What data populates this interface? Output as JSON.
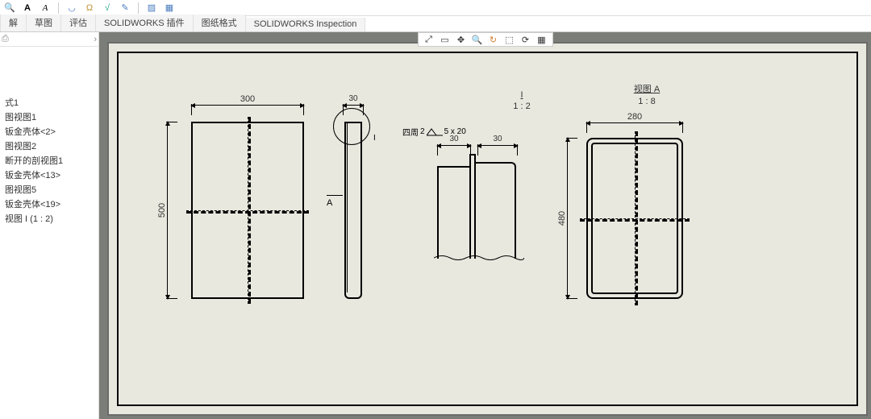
{
  "toolbar_icons": [
    {
      "name": "find-icon",
      "glyph": "🔍"
    },
    {
      "name": "text-icon",
      "glyph": "A"
    },
    {
      "name": "text-style-icon",
      "glyph": "A"
    },
    {
      "name": "arc-icon",
      "glyph": "◡"
    },
    {
      "name": "balloon-icon",
      "glyph": "Ω"
    },
    {
      "name": "check-icon",
      "glyph": "√"
    },
    {
      "name": "centerline-icon",
      "glyph": "✎"
    },
    {
      "name": "hatch-icon",
      "glyph": "▨"
    },
    {
      "name": "block-icon",
      "glyph": "▦"
    }
  ],
  "tabs": [
    {
      "label": "解"
    },
    {
      "label": "草图"
    },
    {
      "label": "评估"
    },
    {
      "label": "SOLIDWORKS 插件"
    },
    {
      "label": "图纸格式"
    },
    {
      "label": "SOLIDWORKS Inspection"
    }
  ],
  "float_icons": [
    {
      "name": "zoom-fit-icon",
      "glyph": "⤢"
    },
    {
      "name": "zoom-window-icon",
      "glyph": "▭"
    },
    {
      "name": "pan-icon",
      "glyph": "✥"
    },
    {
      "name": "zoom-icon",
      "glyph": "🔍"
    },
    {
      "name": "rotate-icon",
      "glyph": "↻"
    },
    {
      "name": "view-icon",
      "glyph": "⬚"
    },
    {
      "name": "refresh-icon",
      "glyph": "⟳"
    },
    {
      "name": "display-icon",
      "glyph": "▦"
    }
  ],
  "tree": {
    "header_icon": "⎙",
    "items": [
      "式1",
      "图视图1",
      "钣金壳体<2>",
      "图视图2",
      "断开的剖视图1",
      "钣金壳体<13>",
      "图视图5",
      "钣金壳体<19>",
      "视图 I (1 : 2)"
    ]
  },
  "drawing": {
    "front": {
      "w": "300",
      "h": "500"
    },
    "side": {
      "w": "30",
      "section_label": "A"
    },
    "detail": {
      "label_num": "I",
      "label_ratio": "1 : 2",
      "note_prefix": "四周",
      "note_val": "5 x 20",
      "d1": "2",
      "d2": "30",
      "d3": "30"
    },
    "viewA": {
      "title": "视图 A",
      "ratio": "1 : 8",
      "w": "280",
      "h": "480"
    }
  }
}
